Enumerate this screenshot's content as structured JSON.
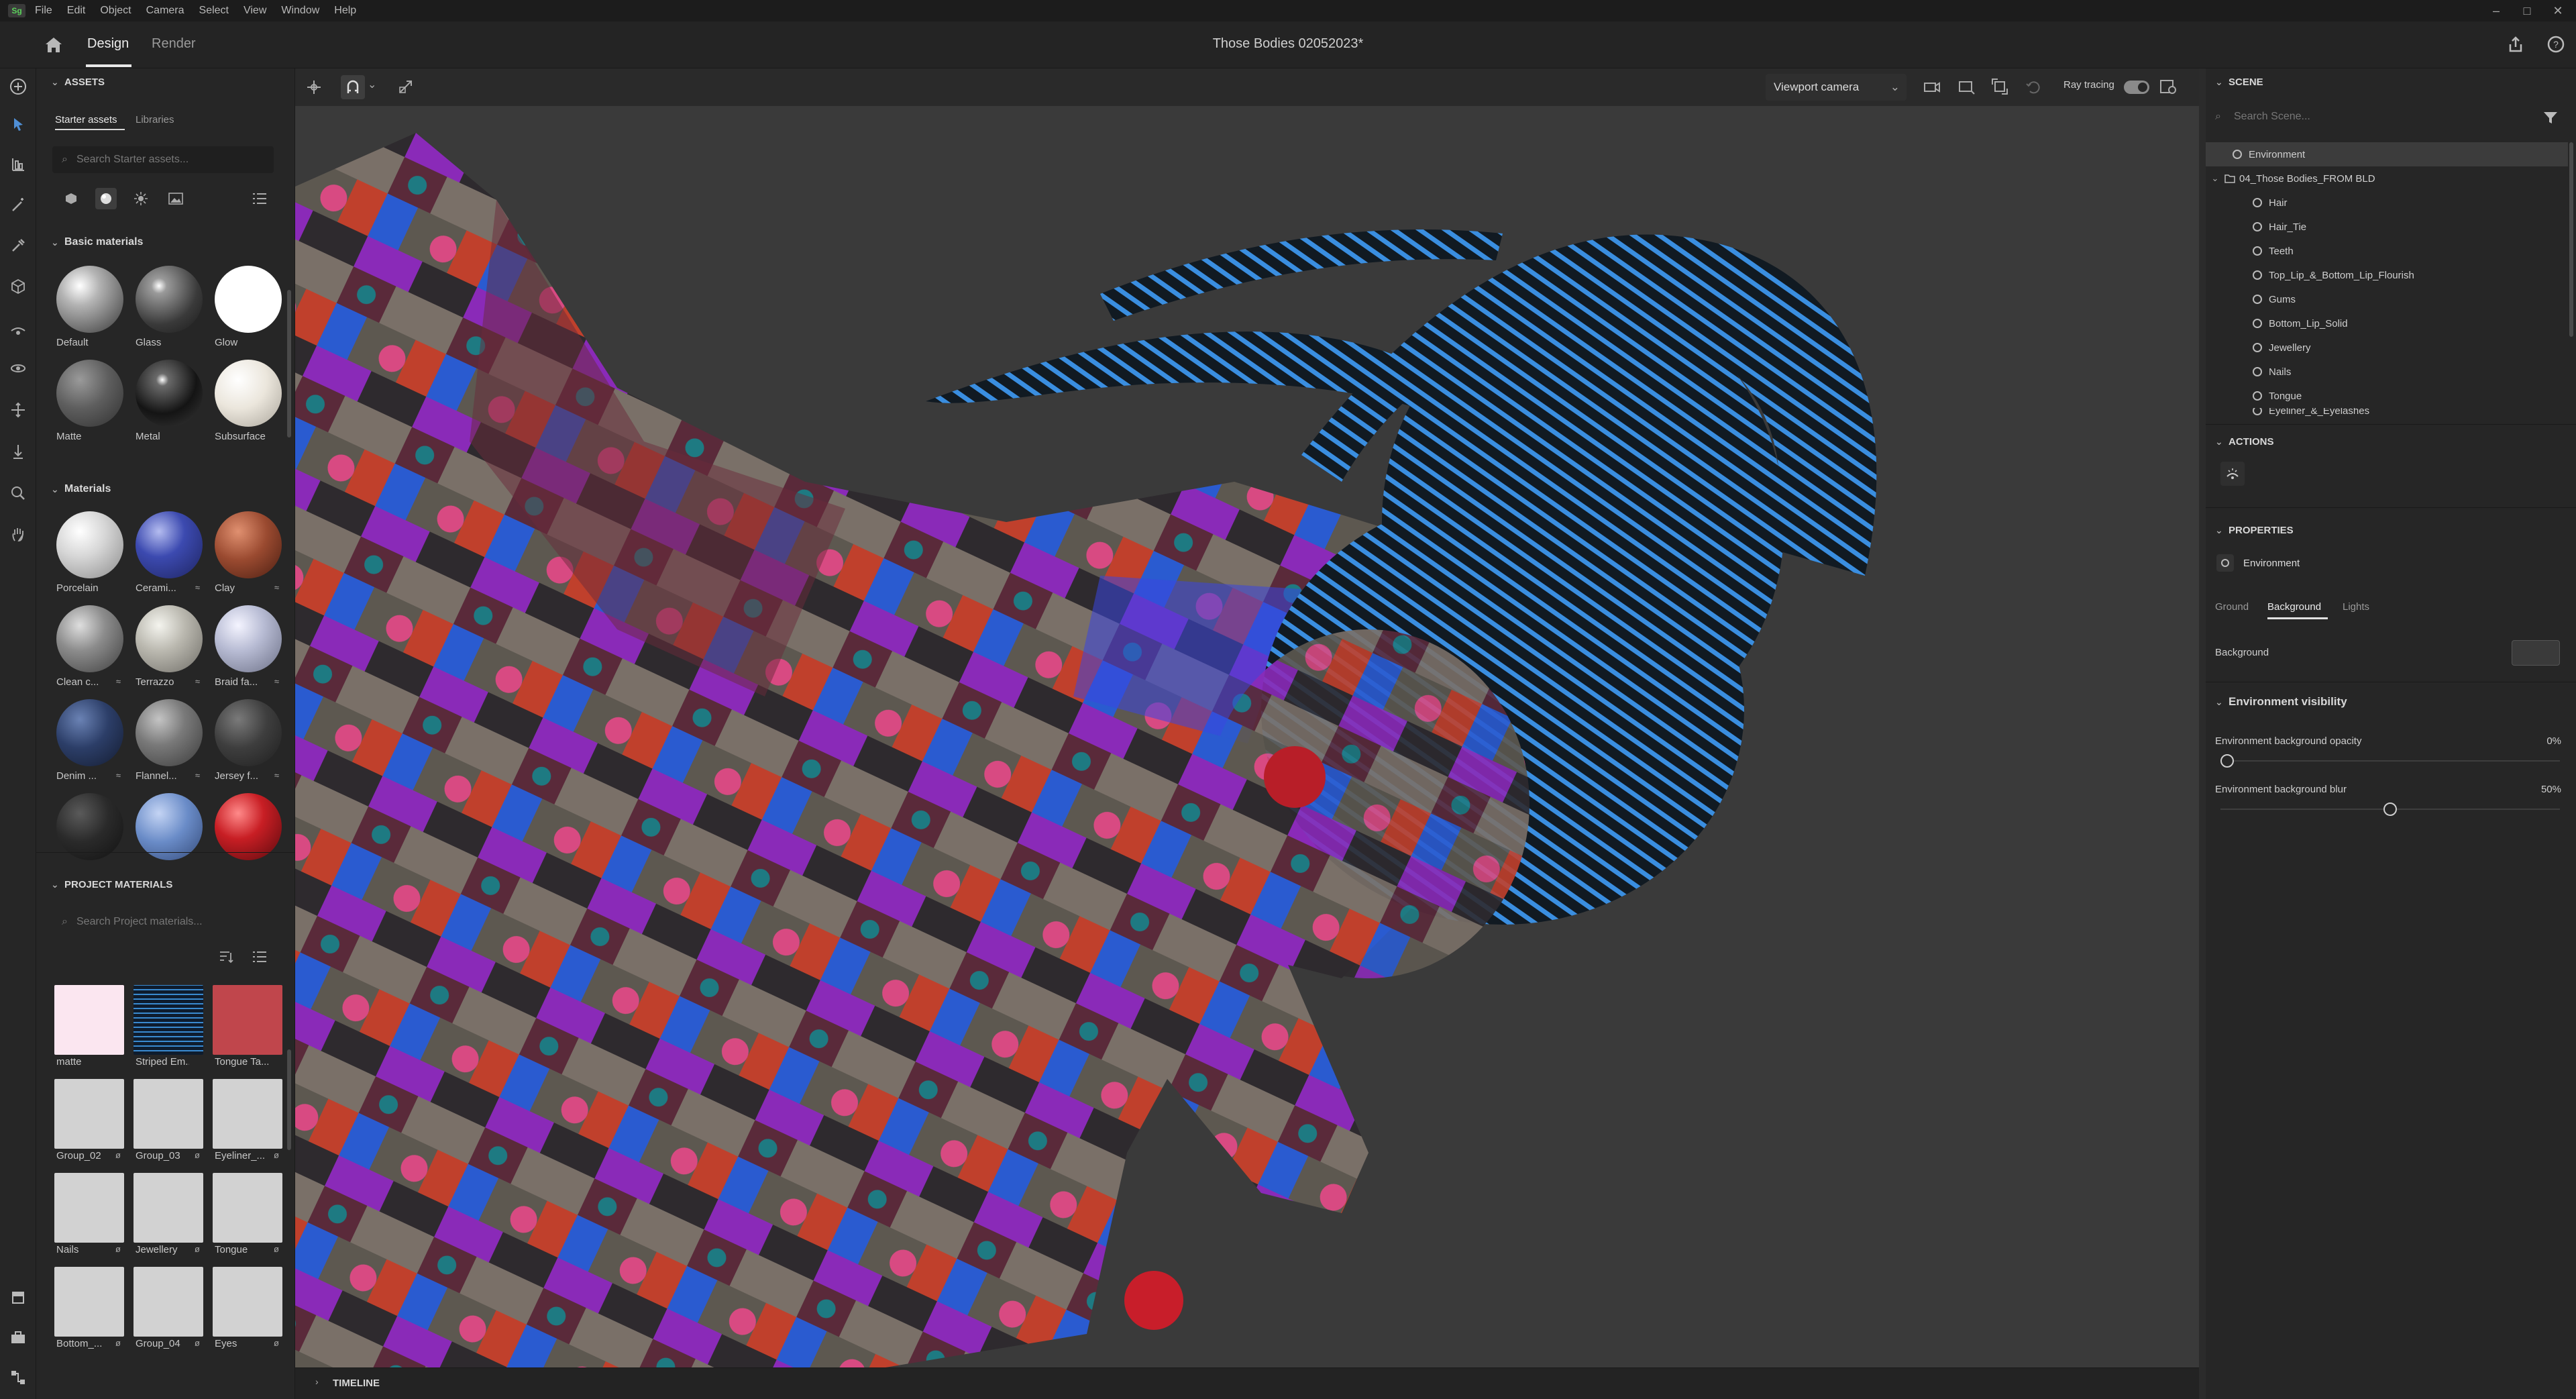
{
  "menubar": {
    "app_badge": "Sg",
    "items": [
      "File",
      "Edit",
      "Object",
      "Camera",
      "Select",
      "View",
      "Window",
      "Help"
    ],
    "window_controls": [
      "–",
      "□",
      "✕"
    ]
  },
  "header": {
    "tabs": [
      "Design",
      "Render"
    ],
    "active_tab": "Design",
    "doc_title": "Those Bodies 02052023*"
  },
  "assets": {
    "section_title": "ASSETS",
    "subtabs": [
      "Starter assets",
      "Libraries"
    ],
    "search_placeholder": "Search Starter assets...",
    "basic_materials": {
      "title": "Basic materials",
      "items": [
        {
          "label": "Default",
          "color": "#9a9a9a"
        },
        {
          "label": "Glass",
          "color": "#555555"
        },
        {
          "label": "Glow",
          "color": "#ffffff"
        },
        {
          "label": "Matte",
          "color": "#6a6a6a"
        },
        {
          "label": "Metal",
          "color": "#2a2a2a"
        },
        {
          "label": "Subsurface",
          "color": "#e8e4dc"
        }
      ]
    },
    "materials": {
      "title": "Materials",
      "items": [
        {
          "label": "Porcelain",
          "color": "#dcdcdc",
          "badge": ""
        },
        {
          "label": "Cerami...",
          "color": "#3a4aa8",
          "badge": "≈"
        },
        {
          "label": "Clay",
          "color": "#9a4a30",
          "badge": "≈"
        },
        {
          "label": "Clean c...",
          "color": "#8a8a8a",
          "badge": "≈"
        },
        {
          "label": "Terrazzo",
          "color": "#b8b8b0",
          "badge": "≈"
        },
        {
          "label": "Braid fa...",
          "color": "#b8bcd0",
          "badge": "≈"
        },
        {
          "label": "Denim ...",
          "color": "#2c3e68",
          "badge": "≈"
        },
        {
          "label": "Flannel...",
          "color": "#7a7a7a",
          "badge": "≈"
        },
        {
          "label": "Jersey f...",
          "color": "#3e3e3e",
          "badge": "≈"
        },
        {
          "label": "",
          "color": "#2a2a2a",
          "badge": ""
        },
        {
          "label": "",
          "color": "#6a8cc8",
          "badge": ""
        },
        {
          "label": "",
          "color": "#c81e24",
          "badge": ""
        }
      ]
    }
  },
  "project_materials": {
    "title": "PROJECT MATERIALS",
    "search_placeholder": "Search Project materials...",
    "items": [
      {
        "label": "matte",
        "color": "#fbe6f0",
        "badge": ""
      },
      {
        "label": "Striped Em...",
        "color": "#15304a",
        "badge": ""
      },
      {
        "label": "Tongue Ta...",
        "color": "#c0464c",
        "badge": ""
      },
      {
        "label": "Group_02",
        "color": "#d2d2d2",
        "badge": "ø"
      },
      {
        "label": "Group_03",
        "color": "#d2d2d2",
        "badge": "ø"
      },
      {
        "label": "Eyeliner_...",
        "color": "#d2d2d2",
        "badge": "ø"
      },
      {
        "label": "Nails",
        "color": "#d2d2d2",
        "badge": "ø"
      },
      {
        "label": "Jewellery",
        "color": "#d2d2d2",
        "badge": "ø"
      },
      {
        "label": "Tongue",
        "color": "#d2d2d2",
        "badge": "ø"
      },
      {
        "label": "Bottom_...",
        "color": "#d2d2d2",
        "badge": "ø"
      },
      {
        "label": "Group_04",
        "color": "#d2d2d2",
        "badge": "ø"
      },
      {
        "label": "Eyes",
        "color": "#d2d2d2",
        "badge": "ø"
      }
    ],
    "footer_icons": [
      "+",
      "folder-icon",
      "trash-icon",
      "•••"
    ]
  },
  "viewport": {
    "camera_select": "Viewport camera",
    "ray_tracing_label": "Ray tracing",
    "ray_tracing_on": true,
    "timeline_label": "TIMELINE"
  },
  "scene": {
    "title": "SCENE",
    "search_placeholder": "Search Scene...",
    "items": [
      {
        "label": "Environment",
        "level": 0,
        "selected": true
      },
      {
        "label": "04_Those Bodies_FROM BLD",
        "level": 0,
        "selected": false
      },
      {
        "label": "Hair",
        "level": 1,
        "selected": false
      },
      {
        "label": "Hair_Tie",
        "level": 1,
        "selected": false
      },
      {
        "label": "Teeth",
        "level": 1,
        "selected": false
      },
      {
        "label": "Top_Lip_&_Bottom_Lip_Flourish",
        "level": 1,
        "selected": false
      },
      {
        "label": "Gums",
        "level": 1,
        "selected": false
      },
      {
        "label": "Bottom_Lip_Solid",
        "level": 1,
        "selected": false
      },
      {
        "label": "Jewellery",
        "level": 1,
        "selected": false
      },
      {
        "label": "Nails",
        "level": 1,
        "selected": false
      },
      {
        "label": "Tongue",
        "level": 1,
        "selected": false
      },
      {
        "label": "Eyeliner_&_Eyelashes",
        "level": 1,
        "selected": false
      }
    ]
  },
  "actions": {
    "title": "ACTIONS"
  },
  "properties": {
    "title": "PROPERTIES",
    "object": "Environment",
    "tabs": [
      "Ground",
      "Background",
      "Lights"
    ],
    "active_tab": "Background",
    "background_label": "Background",
    "background_color": "#3a3a3a",
    "env_visibility": {
      "title": "Environment visibility",
      "opacity_label": "Environment background opacity",
      "opacity_value": "0%",
      "opacity": 0,
      "blur_label": "Environment background blur",
      "blur_value": "50%",
      "blur": 0.5
    }
  }
}
